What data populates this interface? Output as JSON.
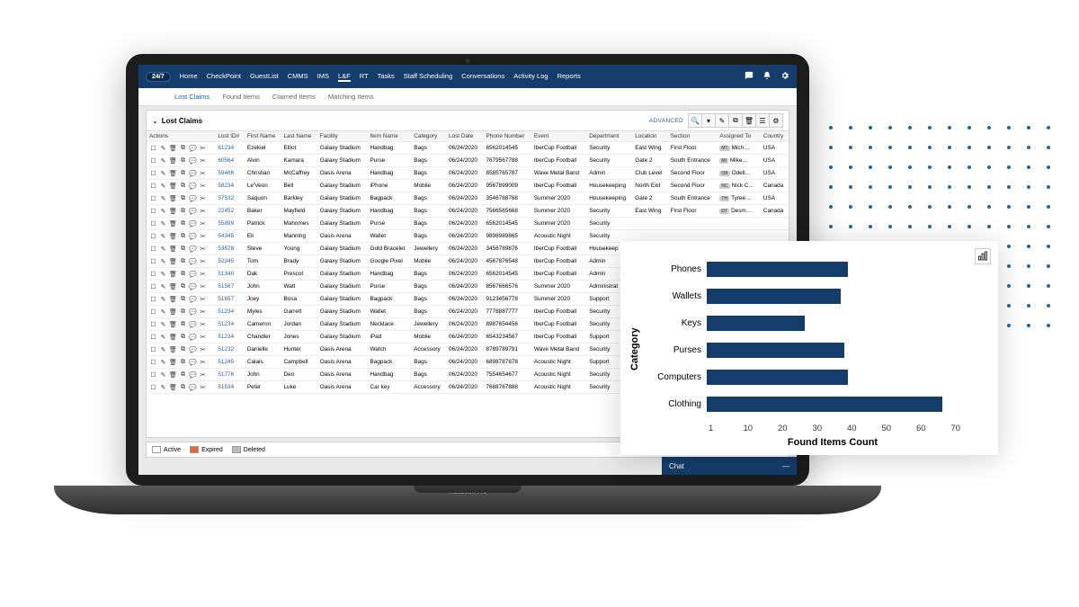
{
  "brand": "24/7",
  "nav": [
    "Home",
    "CheckPoint",
    "GuestList",
    "CMMS",
    "IMS",
    "L&F",
    "RT",
    "Tasks",
    "Staff Scheduling",
    "Conversations",
    "Activity Log",
    "Reports"
  ],
  "active_nav": "L&F",
  "subtabs": [
    "Lost Claims",
    "Found Items",
    "Claimed Items",
    "Matching Items"
  ],
  "active_subtab": "Lost Claims",
  "panel_title": "Lost Claims",
  "advanced_label": "ADVANCED",
  "toolbar_icons": [
    "search",
    "filter",
    "edit",
    "copy",
    "trash",
    "list",
    "gear"
  ],
  "columns": [
    "Actions",
    "Lost ID#",
    "First Name",
    "Last Name",
    "Facility",
    "Item Name",
    "Category",
    "Lost Date",
    "Phone Number",
    "Event",
    "Department",
    "Location",
    "Section",
    "Assigned To",
    "Country"
  ],
  "rows": [
    {
      "id": "61234",
      "first": "Ezekiel",
      "last": "Elliot",
      "facility": "Galaxy Stadium",
      "item": "Handbag",
      "cat": "Bags",
      "date": "06/24/2020",
      "phone": "6562014545",
      "event": "IberCup Football",
      "dept": "Security",
      "loc": "East Wing",
      "sec": "First Floor",
      "assign": "Mich…",
      "country": "USA",
      "badge": "MT"
    },
    {
      "id": "60564",
      "first": "Alvin",
      "last": "Kamara",
      "facility": "Galaxy Stadium",
      "item": "Purse",
      "cat": "Bags",
      "date": "06/24/2020",
      "phone": "7679567788",
      "event": "IberCup Football",
      "dept": "Security",
      "loc": "Gate 2",
      "sec": "South Entrance",
      "assign": "Mike…",
      "country": "USA",
      "badge": "MI",
      "flag": true
    },
    {
      "id": "59466",
      "first": "Christian",
      "last": "McCaffrey",
      "facility": "Oasis Arena",
      "item": "Handbag",
      "cat": "Bags",
      "date": "06/24/2020",
      "phone": "8585765787",
      "event": "Wave Metal Band",
      "dept": "Admin",
      "loc": "Club Level",
      "sec": "Second Floor",
      "assign": "Odell…",
      "country": "USA",
      "badge": "OB"
    },
    {
      "id": "58234",
      "first": "Le'Veon",
      "last": "Bell",
      "facility": "Galaxy Stadium",
      "item": "iPhone",
      "cat": "Mobile",
      "date": "06/24/2020",
      "phone": "9567899009",
      "event": "IberCup Football",
      "dept": "Housekeeping",
      "loc": "North Exit",
      "sec": "Second Floor",
      "assign": "Nick C…",
      "country": "Canada",
      "badge": "NC"
    },
    {
      "id": "57532",
      "first": "Saquon",
      "last": "Barkley",
      "facility": "Galaxy Stadium",
      "item": "Bagpack",
      "cat": "Bags",
      "date": "06/24/2020",
      "phone": "3546788768",
      "event": "Summer 2020",
      "dept": "Housekeeping",
      "loc": "Gate 2",
      "sec": "South Entrance",
      "assign": "Tyree…",
      "country": "USA",
      "badge": "TH"
    },
    {
      "id": "22452",
      "first": "Baker",
      "last": "Mayfield",
      "facility": "Galaxy Stadium",
      "item": "Handbag",
      "cat": "Bags",
      "date": "06/24/2020",
      "phone": "7566565668",
      "event": "Summer 2020",
      "dept": "Security",
      "loc": "East Wing",
      "sec": "First Floor",
      "assign": "Desm…",
      "country": "Canada",
      "badge": "DT"
    },
    {
      "id": "55899",
      "first": "Patrick",
      "last": "Mahomes",
      "facility": "Galaxy Stadium",
      "item": "Purse",
      "cat": "Bags",
      "date": "06/24/2020",
      "phone": "6562014545",
      "event": "Summer 2020",
      "dept": "Security",
      "loc": "",
      "sec": "",
      "assign": "",
      "country": ""
    },
    {
      "id": "54345",
      "first": "Eli",
      "last": "Manning",
      "facility": "Oasis Arena",
      "item": "Wallet",
      "cat": "Bags",
      "date": "06/24/2020",
      "phone": "9898989865",
      "event": "Acoustic Night",
      "dept": "Security",
      "loc": "",
      "sec": "",
      "assign": "",
      "country": ""
    },
    {
      "id": "53678",
      "first": "Steve",
      "last": "Young",
      "facility": "Galaxy Stadium",
      "item": "Gold Bracelet",
      "cat": "Jewellery",
      "date": "06/24/2020",
      "phone": "3456789876",
      "event": "IberCup Football",
      "dept": "Housekeep",
      "loc": "",
      "sec": "",
      "assign": "",
      "country": ""
    },
    {
      "id": "52345",
      "first": "Tom",
      "last": "Brady",
      "facility": "Galaxy Stadium",
      "item": "Google Pixel",
      "cat": "Mobile",
      "date": "06/24/2020",
      "phone": "4567876548",
      "event": "IberCup Football",
      "dept": "Admin",
      "loc": "",
      "sec": "",
      "assign": "",
      "country": "",
      "flag": true
    },
    {
      "id": "51340",
      "first": "Dak",
      "last": "Prescot",
      "facility": "Galaxy Stadium",
      "item": "Handbag",
      "cat": "Bags",
      "date": "06/24/2020",
      "phone": "6562014545",
      "event": "IberCup Football",
      "dept": "Admin",
      "loc": "",
      "sec": "",
      "assign": "",
      "country": ""
    },
    {
      "id": "51567",
      "first": "John",
      "last": "Watt",
      "facility": "Galaxy Stadium",
      "item": "Purse",
      "cat": "Bags",
      "date": "06/24/2020",
      "phone": "8567666576",
      "event": "Summer 2020",
      "dept": "Administrat",
      "loc": "",
      "sec": "",
      "assign": "",
      "country": "",
      "chat": true
    },
    {
      "id": "51657",
      "first": "Joey",
      "last": "Bosa",
      "facility": "Galaxy Stadium",
      "item": "Bagpack",
      "cat": "Bags",
      "date": "06/24/2020",
      "phone": "9123456778",
      "event": "Summer 2020",
      "dept": "Support",
      "loc": "",
      "sec": "",
      "assign": "",
      "country": ""
    },
    {
      "id": "51234",
      "first": "Myles",
      "last": "Garrett",
      "facility": "Galaxy Stadium",
      "item": "Wallet",
      "cat": "Bags",
      "date": "06/24/2020",
      "phone": "7778887777",
      "event": "IberCup Football",
      "dept": "Security",
      "loc": "",
      "sec": "",
      "assign": "",
      "country": ""
    },
    {
      "id": "51234",
      "first": "Cameron",
      "last": "Jordan",
      "facility": "Galaxy Stadium",
      "item": "Necklace",
      "cat": "Jewellery",
      "date": "06/24/2020",
      "phone": "8987654456",
      "event": "IberCup Football",
      "dept": "Security",
      "loc": "",
      "sec": "",
      "assign": "",
      "country": ""
    },
    {
      "id": "51234",
      "first": "Chandler",
      "last": "Jones",
      "facility": "Galaxy Stadium",
      "item": "iPad",
      "cat": "Mobile",
      "date": "06/24/2020",
      "phone": "6543234567",
      "event": "IberCup Football",
      "dept": "Support",
      "loc": "",
      "sec": "",
      "assign": "",
      "country": ""
    },
    {
      "id": "51232",
      "first": "Danielle",
      "last": "Hunter",
      "facility": "Oasis Arena",
      "item": "Watch",
      "cat": "Accessory",
      "date": "06/24/2020",
      "phone": "8789789791",
      "event": "Wave Metal Band",
      "dept": "Security",
      "loc": "",
      "sec": "",
      "assign": "",
      "country": ""
    },
    {
      "id": "51245",
      "first": "Calais",
      "last": "Campbell",
      "facility": "Oasis Arena",
      "item": "Bagpack",
      "cat": "Bags",
      "date": "06/24/2020",
      "phone": "6898787878",
      "event": "Acoustic Night",
      "dept": "Support",
      "loc": "",
      "sec": "",
      "assign": "",
      "country": ""
    },
    {
      "id": "51776",
      "first": "John",
      "last": "Deo",
      "facility": "Oasis Arena",
      "item": "Handbag",
      "cat": "Bags",
      "date": "06/24/2020",
      "phone": "7554654677",
      "event": "Acoustic Night",
      "dept": "Security",
      "loc": "",
      "sec": "",
      "assign": "",
      "country": ""
    },
    {
      "id": "51534",
      "first": "Peter",
      "last": "Luke",
      "facility": "Oasis Arena",
      "item": "Car key",
      "cat": "Accessory",
      "date": "06/24/2020",
      "phone": "7688767888",
      "event": "Acoustic Night",
      "dept": "Security",
      "loc": "",
      "sec": "",
      "assign": "",
      "country": ""
    }
  ],
  "legend": {
    "active": "Active",
    "expired": "Expired",
    "deleted": "Deleted"
  },
  "chat_label": "Chat",
  "laptop_label": "MacBook Pro",
  "chart_data": {
    "type": "bar",
    "orientation": "horizontal",
    "categories": [
      "Phones",
      "Wallets",
      "Keys",
      "Purses",
      "Computers",
      "Clothing"
    ],
    "values": [
      36,
      34,
      25,
      35,
      36,
      60
    ],
    "xlabel": "Found Items Count",
    "ylabel": "Category",
    "xticks": [
      1,
      10,
      20,
      30,
      40,
      50,
      60,
      70
    ],
    "xlim": [
      0,
      70
    ]
  }
}
